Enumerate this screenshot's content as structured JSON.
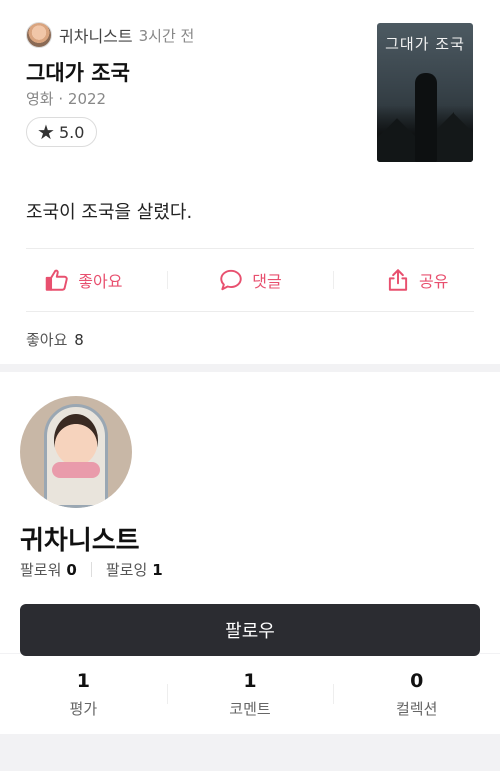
{
  "review": {
    "author": "귀차니스트",
    "time": "3시간 전",
    "movie_title": "그대가 조국",
    "movie_meta": "영화 · 2022",
    "rating": "5.0",
    "poster_text": "그대가 조국",
    "text": "조국이 조국을 살렸다.",
    "actions": {
      "like": "좋아요",
      "comment": "댓글",
      "share": "공유"
    },
    "likes_label": "좋아요",
    "likes_count": "8"
  },
  "profile": {
    "name": "귀차니스트",
    "followers_label": "팔로워",
    "followers_count": "0",
    "following_label": "팔로잉",
    "following_count": "1",
    "follow_button": "팔로우"
  },
  "stats": [
    {
      "value": "1",
      "label": "평가"
    },
    {
      "value": "1",
      "label": "코멘트"
    },
    {
      "value": "0",
      "label": "컬렉션"
    }
  ],
  "icons": {
    "star": "star-icon",
    "like": "thumbs-up-icon",
    "comment": "speech-bubble-icon",
    "share": "share-icon"
  },
  "colors": {
    "accent": "#e8506f",
    "button_dark": "#2b2c31"
  }
}
